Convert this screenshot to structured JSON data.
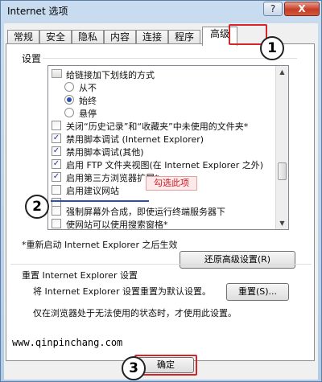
{
  "window": {
    "title": "Internet 选项",
    "help_glyph": "?",
    "close_glyph": "X"
  },
  "tabs": [
    {
      "label": "常规"
    },
    {
      "label": "安全"
    },
    {
      "label": "隐私"
    },
    {
      "label": "内容"
    },
    {
      "label": "连接"
    },
    {
      "label": "程序"
    },
    {
      "label": "高级"
    }
  ],
  "settings_label": "设置",
  "list": {
    "items": [
      {
        "kind": "group",
        "label": "给链接加下划线的方式"
      },
      {
        "kind": "radio",
        "label": "从不",
        "selected": false
      },
      {
        "kind": "radio",
        "label": "始终",
        "selected": true
      },
      {
        "kind": "radio",
        "label": "悬停",
        "selected": false
      },
      {
        "kind": "checkbox",
        "label": "关闭“历史记录”和“收藏夹”中未使用的文件夹*",
        "checked": false
      },
      {
        "kind": "checkbox",
        "label": "禁用脚本调试 (Internet Explorer)",
        "checked": true
      },
      {
        "kind": "checkbox",
        "label": "禁用脚本调试(其他)",
        "checked": true
      },
      {
        "kind": "checkbox",
        "label": "启用 FTP 文件夹视图(在 Internet Explorer 之外)",
        "checked": true
      },
      {
        "kind": "checkbox",
        "label": "启用第三方浏览器扩展*",
        "checked": true
      },
      {
        "kind": "checkbox",
        "label": "启用建议网站",
        "checked": false
      },
      {
        "kind": "checkbox",
        "label": "",
        "checked": false
      },
      {
        "kind": "checkbox",
        "label": "强制屏幕外合成，即使运行终端服务器下",
        "checked": false
      },
      {
        "kind": "checkbox",
        "label": "使网站可以使用搜索窗格*",
        "checked": false
      }
    ]
  },
  "hint_text": "勾选此项",
  "restart_note": "*重新启动 Internet Explorer 之后生效",
  "restore_button": "还原高级设置(R)",
  "reset": {
    "title": "重置 Internet Explorer 设置",
    "description": "将 Internet Explorer 设置重置为默认设置。",
    "button": "重置(S)...",
    "warning": "仅在浏览器处于无法使用的状态时，才使用此设置。"
  },
  "ok_button": "确定",
  "watermark": "www.qinpinchang.com",
  "callouts": [
    "1",
    "2",
    "3"
  ],
  "colors": {
    "callout_red": "#d8232a",
    "hint_text": "#c81d25",
    "close_red": "#c63c24"
  }
}
